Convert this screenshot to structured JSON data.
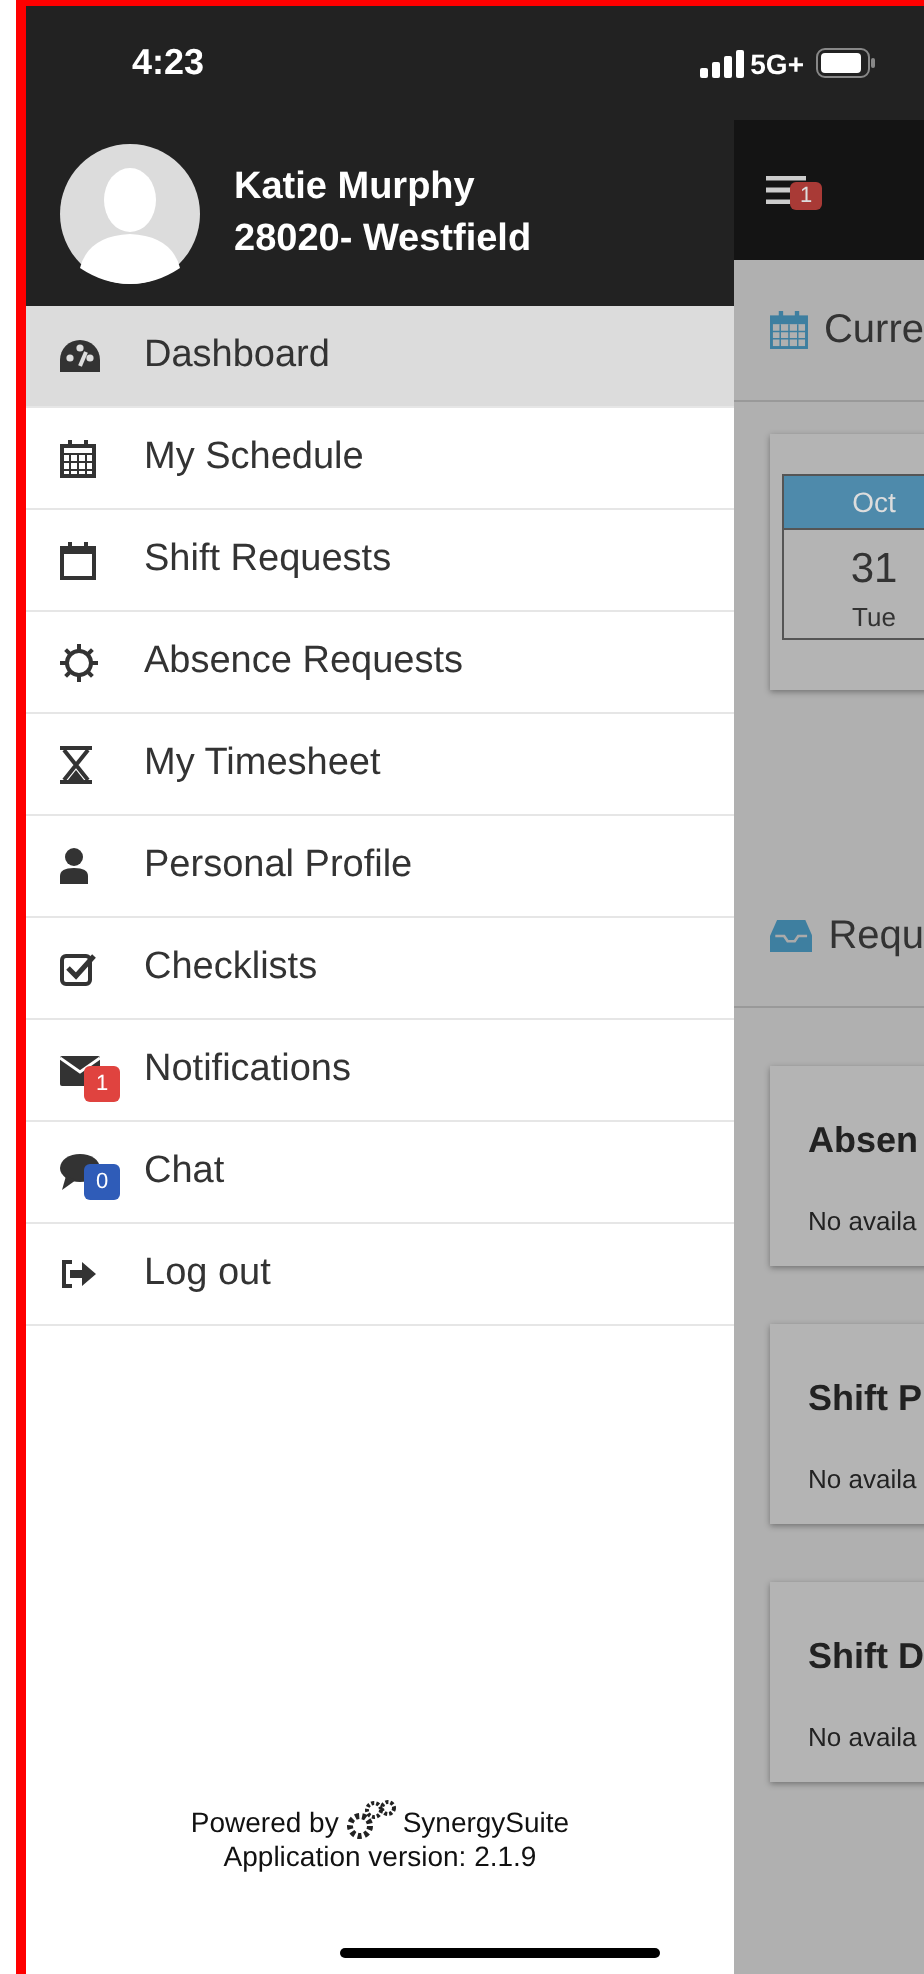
{
  "status_bar": {
    "time": "4:23",
    "network": "5G+"
  },
  "profile": {
    "name": "Katie Murphy",
    "location": "28020- Westfield"
  },
  "menu": [
    {
      "label": "Dashboard",
      "selected": true
    },
    {
      "label": "My Schedule",
      "selected": false
    },
    {
      "label": "Shift Requests",
      "selected": false
    },
    {
      "label": "Absence Requests",
      "selected": false
    },
    {
      "label": "My Timesheet",
      "selected": false
    },
    {
      "label": "Personal Profile",
      "selected": false
    },
    {
      "label": "Checklists",
      "selected": false
    },
    {
      "label": "Notifications",
      "selected": false,
      "badge": "1",
      "color": "#e0433f"
    },
    {
      "label": "Chat",
      "selected": false,
      "badge": "0",
      "color": "#2f5cb8"
    },
    {
      "label": "Log out",
      "selected": false
    }
  ],
  "footer": {
    "powered_by": "Powered by",
    "brand": "SynergySuite",
    "version": "Application version: 2.1.9"
  },
  "background_page": {
    "menu_badge": "1",
    "sections": [
      {
        "title": "Curre",
        "kind": "date",
        "date": {
          "month": "Oct",
          "day": "31",
          "weekday": "Tue"
        }
      },
      {
        "title": "Requ",
        "kind": "requests",
        "cards": [
          {
            "title": "Absen",
            "text": "No availa"
          },
          {
            "title": "Shift P",
            "text": "No availa"
          },
          {
            "title": "Shift D",
            "text": "No availa"
          }
        ]
      }
    ]
  }
}
